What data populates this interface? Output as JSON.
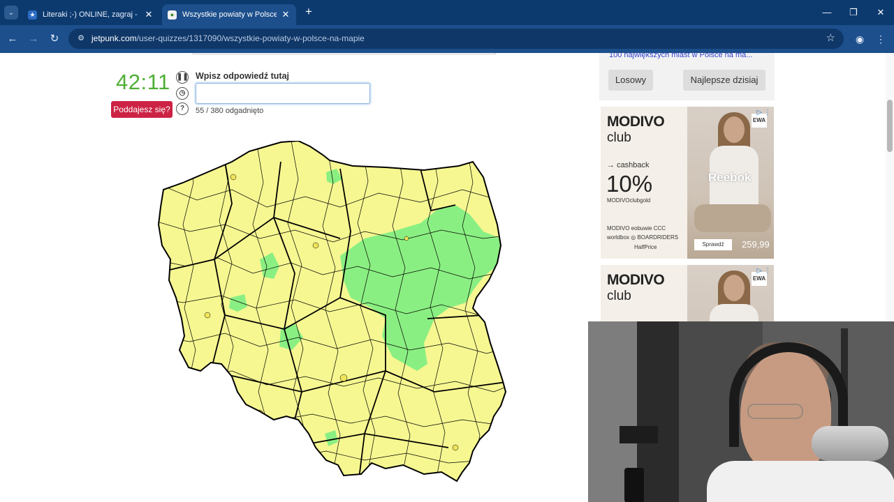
{
  "browser": {
    "tabs": [
      {
        "title": "Literaki ;-) ONLINE, zagraj - Kur",
        "favicon": "star-icon",
        "active": false
      },
      {
        "title": "Wszystkie powiaty w Polsce na m",
        "favicon": "jetpunk-icon",
        "active": true
      }
    ],
    "url_host": "jetpunk.com",
    "url_path": "/user-quizzes/1317090/wszystkie-powiaty-w-polsce-na-mapie",
    "colors": {
      "tabbar": "#0c3a6e",
      "toolbar": "#1c4f8c"
    }
  },
  "quiz": {
    "timer": "42:11",
    "give_up_label": "Poddajesz się?",
    "prompt": "Wpisz odpowiedź tutaj",
    "answer_value": "",
    "progress_text": "55 / 380 odgadnięto",
    "icons": [
      "pause-icon",
      "clock-icon",
      "help-icon"
    ],
    "map_colors": {
      "unanswered": "#f6f791",
      "answered": "#8aef82",
      "border": "#000000"
    }
  },
  "sidebar": {
    "link": "100 największych miast w Polsce na ma...",
    "random_label": "Losowy",
    "best_today_label": "Najlepsze dzisiaj"
  },
  "ads": [
    {
      "brand_line1": "MODIVO",
      "brand_line2": "club",
      "cashback_label": "cashback",
      "percent": "10%",
      "clubgold": "MODIVOclubgold",
      "logos_row1": "MODIVO   eobuwie   CCC",
      "logos_row2": "worldbox  ◎ BOARDRIDERS",
      "logos_row3": "HalfPrice",
      "photo_brand": "Reebok",
      "badge": "EWA",
      "cta": "Sprawdź",
      "price": "259,99"
    },
    {
      "brand_line1": "MODIVO",
      "brand_line2": "club",
      "badge": "EWA"
    }
  ]
}
